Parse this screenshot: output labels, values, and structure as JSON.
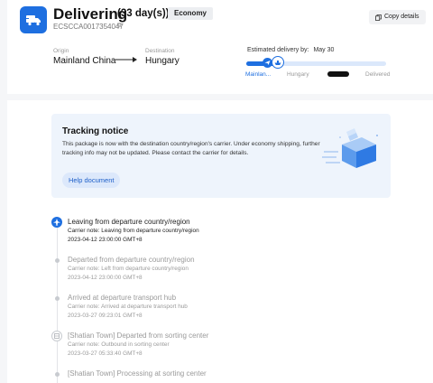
{
  "header": {
    "status": "Delivering",
    "days": "(33 day(s))",
    "badge": "Economy",
    "tracking_number": "ECSCCA0017354047",
    "copy_icon_glyph": "⧉",
    "copy_button_label": "Copy details",
    "brand_color": "#1e6fe0"
  },
  "route": {
    "origin_label": "Origin",
    "origin": "Mainland China",
    "destination_label": "Destination",
    "destination": "Hungary"
  },
  "progress": {
    "eta_label": "Estimated delivery by:",
    "eta_date": "May 30",
    "fraction": 0.22,
    "stops": [
      "Mainlan...",
      "Hungary",
      "Delivered"
    ]
  },
  "notice": {
    "title": "Tracking notice",
    "text": "This package is now with the destination country/region's carrier. Under economy shipping, further tracking info may not be updated. Please contact the carrier for details.",
    "button": "Help document"
  },
  "events": [
    {
      "title": "Leaving from departure country/region",
      "note": "Carrier note: Leaving from departure country/region",
      "time": "2023-04-12 23:00:00 GMT+8",
      "icon": "plane-icon"
    },
    {
      "title": "Departed from departure country/region",
      "note": "Carrier note: Left from departure country/region",
      "time": "2023-04-12 23:00:00 GMT+8",
      "icon": "dot-icon"
    },
    {
      "title": "Arrived at departure transport hub",
      "note": "Carrier note: Arrived at departure transport hub",
      "time": "2023-03-27 09:23:01 GMT+8",
      "icon": "dot-icon"
    },
    {
      "title": "[Shatian Town] Departed from sorting center",
      "note": "Carrier note: Outbound in sorting center",
      "time": "2023-03-27 05:33:40 GMT+8",
      "icon": "sorting-icon"
    },
    {
      "title": "[Shatian Town] Processing at sorting center",
      "note": "",
      "time": "",
      "icon": "dot-icon"
    }
  ]
}
